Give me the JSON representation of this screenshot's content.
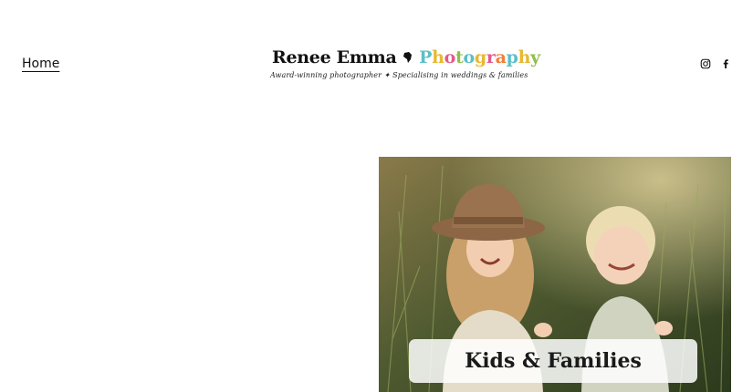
{
  "nav": {
    "home_label": "Home"
  },
  "logo": {
    "name": "Renee Emma",
    "photography_letters": [
      {
        "ch": "P",
        "color": "#5bbfc7"
      },
      {
        "ch": "h",
        "color": "#e8b830"
      },
      {
        "ch": "o",
        "color": "#e35a8c"
      },
      {
        "ch": "t",
        "color": "#8fbf4d"
      },
      {
        "ch": "o",
        "color": "#5bbfc7"
      },
      {
        "ch": "g",
        "color": "#e8b830"
      },
      {
        "ch": "r",
        "color": "#e35a8c"
      },
      {
        "ch": "a",
        "color": "#f07f3c"
      },
      {
        "ch": "p",
        "color": "#5bbfc7"
      },
      {
        "ch": "h",
        "color": "#e8b830"
      },
      {
        "ch": "y",
        "color": "#8fbf4d"
      }
    ],
    "tagline": "Award-winning photographer ✦ Specialising in weddings & families"
  },
  "social": {
    "instagram_icon": "instagram-icon",
    "facebook_icon": "facebook-icon"
  },
  "card": {
    "label": "Kids & Families"
  },
  "colors": {
    "text": "#111111",
    "background": "#ffffff"
  }
}
